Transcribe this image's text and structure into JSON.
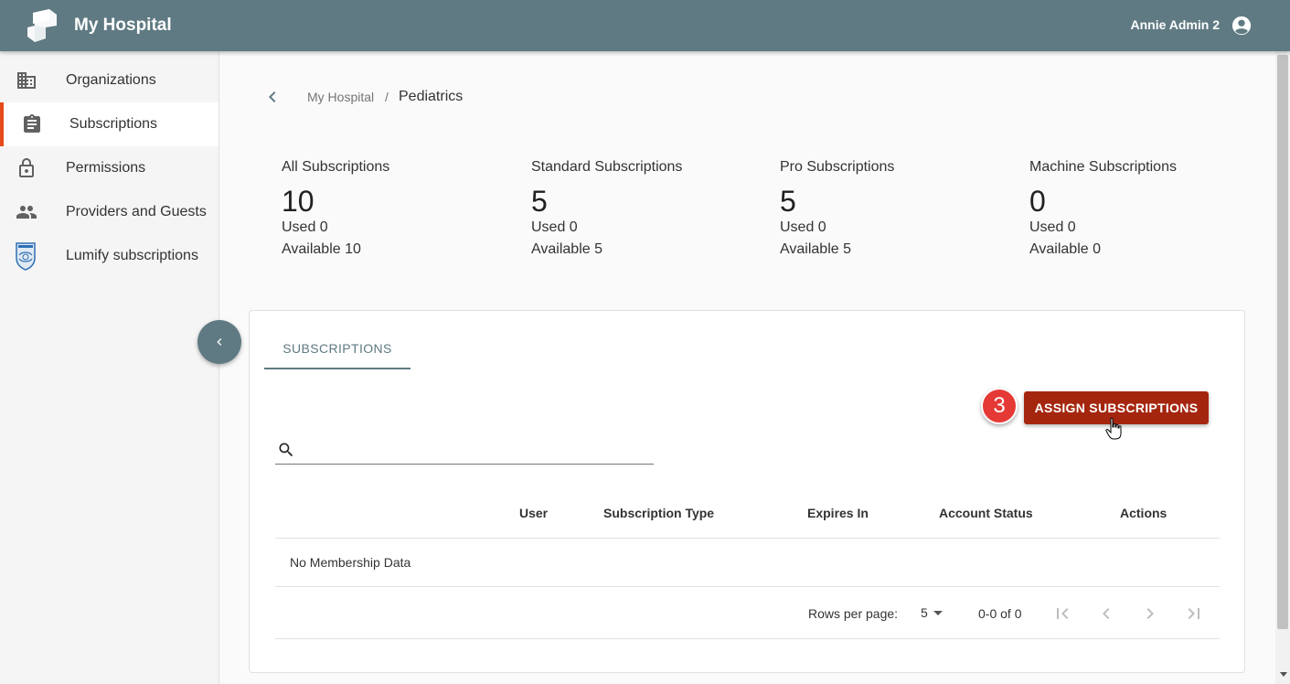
{
  "header": {
    "app_title": "My Hospital",
    "user_name": "Annie Admin 2",
    "logo_icon": "hospital-logo-icon",
    "user_icon": "account-circle-icon",
    "bar_color": "#5f7a82"
  },
  "sidebar": {
    "items": [
      {
        "label": "Organizations",
        "icon": "building-icon",
        "active": false
      },
      {
        "label": "Subscriptions",
        "icon": "clipboard-icon",
        "active": true
      },
      {
        "label": "Permissions",
        "icon": "lock-icon",
        "active": false
      },
      {
        "label": "Providers and Guests",
        "icon": "people-icon",
        "active": false
      },
      {
        "label": "Lumify subscriptions",
        "icon": "philips-shield-icon",
        "active": false
      }
    ],
    "active_accent": "#e64a19",
    "collapse_icon": "chevron-left-icon"
  },
  "breadcrumb": {
    "parent": "My Hospital",
    "separator": "/",
    "current": "Pediatrics"
  },
  "stats": [
    {
      "title": "All Subscriptions",
      "total": "10",
      "used": "Used 0",
      "available": "Available 10"
    },
    {
      "title": "Standard Subscriptions",
      "total": "5",
      "used": "Used 0",
      "available": "Available 5"
    },
    {
      "title": "Pro Subscriptions",
      "total": "5",
      "used": "Used 0",
      "available": "Available 5"
    },
    {
      "title": "Machine Subscriptions",
      "total": "0",
      "used": "Used 0",
      "available": "Available 0"
    }
  ],
  "card": {
    "tab_label": "SUBSCRIPTIONS",
    "step_badge": "3",
    "assign_button": "ASSIGN SUBSCRIPTIONS",
    "assign_color": "#a5260f",
    "search_placeholder": "",
    "columns": [
      "User",
      "Subscription Type",
      "Expires In",
      "Account Status",
      "Actions"
    ],
    "empty_message": "No Membership Data",
    "pager": {
      "rows_label": "Rows per page:",
      "rows_value": "5",
      "range": "0-0 of 0",
      "icons": [
        "first-page-icon",
        "prev-page-icon",
        "next-page-icon",
        "last-page-icon"
      ]
    }
  }
}
